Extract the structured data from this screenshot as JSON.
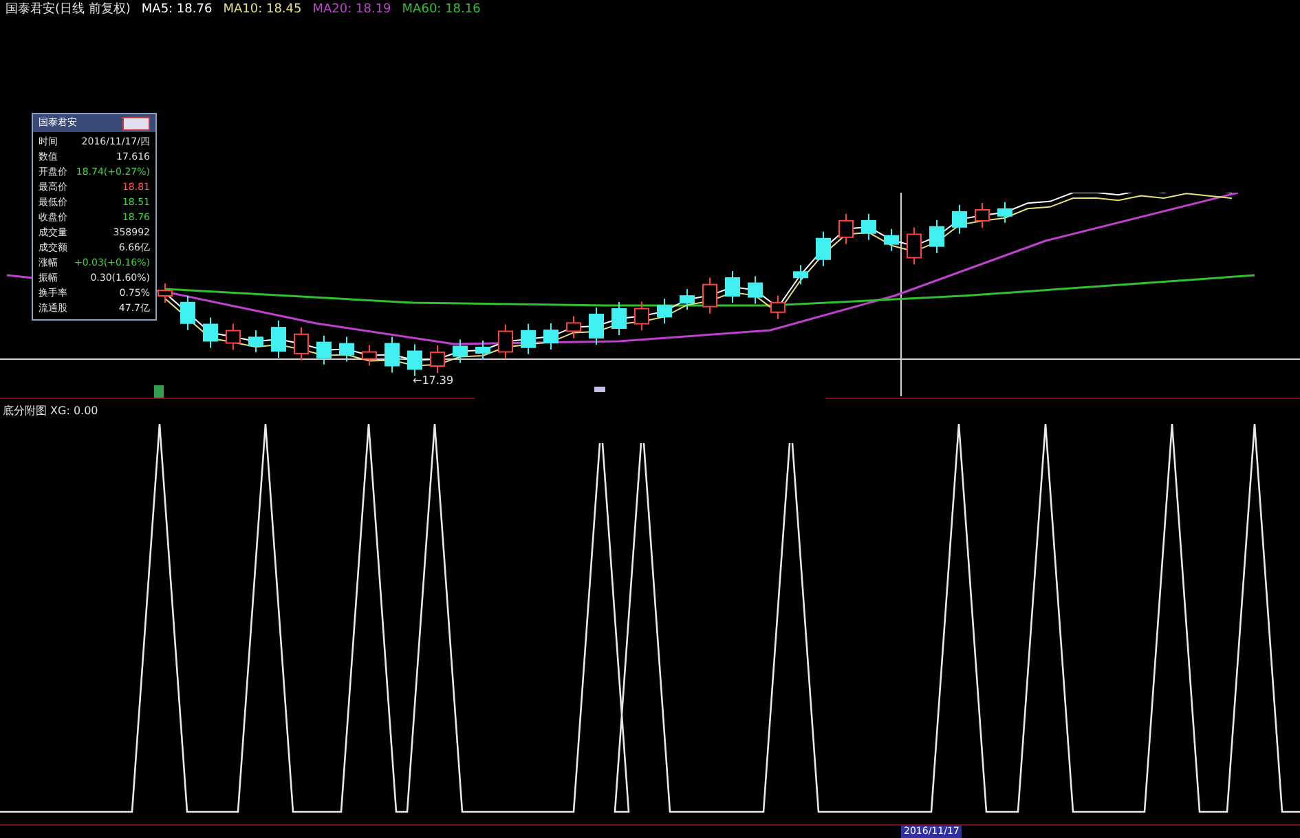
{
  "chart_title": {
    "name": "国泰君安(日线 前复权)",
    "averages": [
      {
        "label": "MA5: 18.76",
        "color": "#ffffff"
      },
      {
        "label": "MA10: 18.45",
        "color": "#e8e07a"
      },
      {
        "label": "MA20: 18.19",
        "color": "#c040d0"
      },
      {
        "label": "MA60: 18.16",
        "color": "#30c030"
      }
    ]
  },
  "info_box": {
    "title": "国泰君安",
    "rows": [
      {
        "label": "时间",
        "value": "2016/11/17/四",
        "color": "#e0e0e0"
      },
      {
        "label": "数值",
        "value": "17.616",
        "color": "#e0e0e0"
      },
      {
        "label": "开盘价",
        "value": "18.74(+0.27%)",
        "color": "#40d040"
      },
      {
        "label": "最高价",
        "value": "18.81",
        "color": "#ff5050"
      },
      {
        "label": "最低价",
        "value": "18.51",
        "color": "#40d040"
      },
      {
        "label": "收盘价",
        "value": "18.76",
        "color": "#40d040"
      },
      {
        "label": "成交量",
        "value": "358992",
        "color": "#e0e0e0"
      },
      {
        "label": "成交额",
        "value": "6.66亿",
        "color": "#e0e0e0"
      },
      {
        "label": "涨幅",
        "value": "+0.03(+0.16%)",
        "color": "#40d040"
      },
      {
        "label": "振幅",
        "value": "0.30(1.60%)",
        "color": "#e0e0e0"
      },
      {
        "label": "换手率",
        "value": "0.75%",
        "color": "#e0e0e0"
      },
      {
        "label": "流通股",
        "value": "47.7亿",
        "color": "#e0e0e0"
      }
    ]
  },
  "low_marker": "←17.39",
  "sub_chart": {
    "title": "底分附图 XG: 0.00"
  },
  "axis_date": "2016/11/17"
}
